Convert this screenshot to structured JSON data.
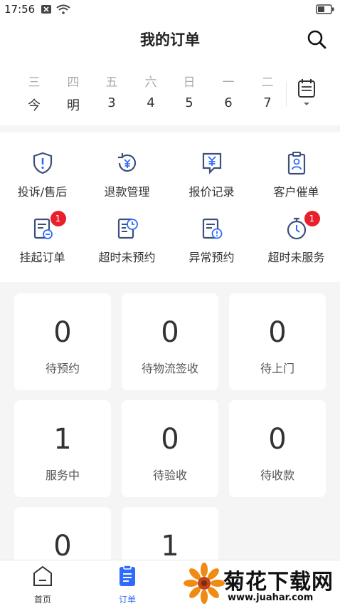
{
  "status_bar": {
    "time": "17:56"
  },
  "header": {
    "title": "我的订单"
  },
  "calendar": {
    "days": [
      {
        "weekday": "三",
        "date": "今"
      },
      {
        "weekday": "四",
        "date": "明"
      },
      {
        "weekday": "五",
        "date": "3"
      },
      {
        "weekday": "六",
        "date": "4"
      },
      {
        "weekday": "日",
        "date": "5"
      },
      {
        "weekday": "一",
        "date": "6"
      },
      {
        "weekday": "二",
        "date": "7"
      }
    ]
  },
  "quick_actions": [
    {
      "label": "投诉/售后",
      "icon": "shield-alert-icon"
    },
    {
      "label": "退款管理",
      "icon": "refund-icon"
    },
    {
      "label": "报价记录",
      "icon": "quote-icon"
    },
    {
      "label": "客户催单",
      "icon": "clipboard-user-icon"
    },
    {
      "label": "挂起订单",
      "icon": "suspend-order-icon",
      "badge": "1"
    },
    {
      "label": "超时未预约",
      "icon": "timeout-booking-icon"
    },
    {
      "label": "异常预约",
      "icon": "abnormal-booking-icon"
    },
    {
      "label": "超时未服务",
      "icon": "stopwatch-icon",
      "badge": "1"
    }
  ],
  "order_status": [
    {
      "count": "0",
      "label": "待预约"
    },
    {
      "count": "0",
      "label": "待物流签收"
    },
    {
      "count": "0",
      "label": "待上门"
    },
    {
      "count": "1",
      "label": "服务中"
    },
    {
      "count": "0",
      "label": "待验收"
    },
    {
      "count": "0",
      "label": "待收款"
    },
    {
      "count": "0",
      "label": ""
    },
    {
      "count": "1",
      "label": ""
    }
  ],
  "tabbar": {
    "home": "首页",
    "orders": "订单"
  },
  "watermark": {
    "title": "菊花下载网",
    "url": "www.juahar.com"
  },
  "colors": {
    "accent": "#2f6bff",
    "badge": "#e8202c",
    "icon": "#3d4f7a",
    "background": "#f5f5f5"
  }
}
